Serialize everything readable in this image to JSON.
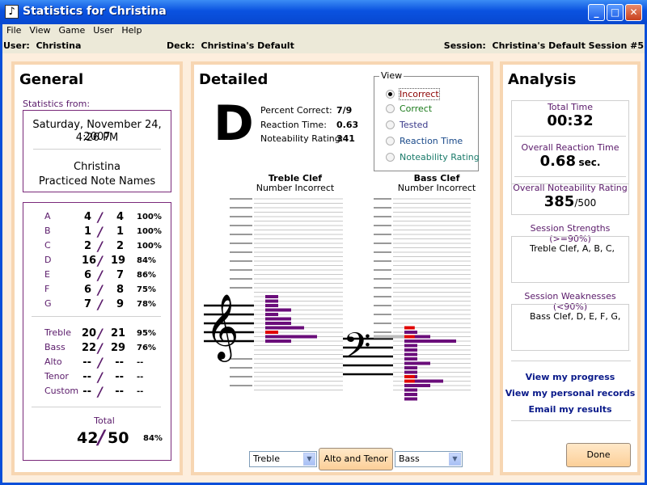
{
  "window": {
    "title": "Statistics for Christina"
  },
  "menu": [
    "File",
    "View",
    "Game",
    "User",
    "Help"
  ],
  "infobar": {
    "user_label": "User:",
    "user": "Christina",
    "deck_label": "Deck:",
    "deck": "Christina's Default",
    "session_label": "Session:",
    "session": "Christina's Default Session #5"
  },
  "general": {
    "title": "General",
    "stats_from_label": "Statistics from:",
    "date": "Saturday, November 24, 2007",
    "time": "4:26 PM",
    "user": "Christina",
    "activity": "Practiced Note Names",
    "notes": [
      {
        "label": "A",
        "a": "4",
        "b": "4",
        "pct": "100%"
      },
      {
        "label": "B",
        "a": "1",
        "b": "1",
        "pct": "100%"
      },
      {
        "label": "C",
        "a": "2",
        "b": "2",
        "pct": "100%"
      },
      {
        "label": "D",
        "a": "16",
        "b": "19",
        "pct": "84%"
      },
      {
        "label": "E",
        "a": "6",
        "b": "7",
        "pct": "86%"
      },
      {
        "label": "F",
        "a": "6",
        "b": "8",
        "pct": "75%"
      },
      {
        "label": "G",
        "a": "7",
        "b": "9",
        "pct": "78%"
      }
    ],
    "clefs": [
      {
        "label": "Treble",
        "a": "20",
        "b": "21",
        "pct": "95%"
      },
      {
        "label": "Bass",
        "a": "22",
        "b": "29",
        "pct": "76%"
      },
      {
        "label": "Alto",
        "a": "--",
        "b": "--",
        "pct": "--"
      },
      {
        "label": "Tenor",
        "a": "--",
        "b": "--",
        "pct": "--"
      },
      {
        "label": "Custom",
        "a": "--",
        "b": "--",
        "pct": "--"
      }
    ],
    "total_label": "Total",
    "total_a": "42",
    "total_b": "50",
    "total_pct": "84%"
  },
  "detailed": {
    "title": "Detailed",
    "grade": "D",
    "percent_correct_label": "Percent Correct:",
    "percent_correct": "7/9",
    "reaction_time_label": "Reaction Time:",
    "reaction_time": "0.63",
    "noteability_label": "Noteability Rating:",
    "noteability": "341",
    "view_legend": "View",
    "view_options": [
      "Incorrect",
      "Correct",
      "Tested",
      "Reaction Time",
      "Noteability Rating"
    ],
    "view_colors": [
      "#8b0000",
      "#1a7a1a",
      "#3a3a8a",
      "#1a4a8a",
      "#1a7a6a"
    ],
    "treble_title": "Treble Clef",
    "treble_sub": "Number Incorrect",
    "bass_title": "Bass Clef",
    "bass_sub": "Number Incorrect",
    "select_left": "Treble",
    "alto_tenor_button": "Alto and Tenor",
    "select_right": "Bass"
  },
  "analysis": {
    "title": "Analysis",
    "total_time_label": "Total Time",
    "total_time": "00:32",
    "reaction_label": "Overall Reaction Time",
    "reaction_value": "0.68",
    "reaction_unit": "sec.",
    "noteability_label": "Overall Noteability Rating",
    "noteability_value": "385",
    "noteability_unit": "/500",
    "strengths_label": "Session Strengths (>=90%)",
    "strengths": "Treble Clef, A, B, C,",
    "weaknesses_label": "Session Weaknesses (<90%)",
    "weaknesses": "Bass Clef, D, E, F, G,",
    "links": [
      "View my progress",
      "View my personal records",
      "Email my results"
    ],
    "done_button": "Done"
  },
  "chart_data": [
    {
      "type": "bar",
      "title": "Treble Clef",
      "subtitle": "Number Incorrect",
      "series": [
        {
          "values": [
            1,
            1,
            1,
            2,
            1,
            2,
            2,
            3,
            1,
            4,
            2
          ]
        },
        {
          "values": [
            0,
            0,
            0,
            0,
            0,
            0,
            0,
            0,
            1,
            0,
            0
          ]
        }
      ],
      "colors": [
        "#6a0d7a",
        "#e00000"
      ]
    },
    {
      "type": "bar",
      "title": "Bass Clef",
      "subtitle": "Number Incorrect",
      "series": [
        {
          "values": [
            0,
            1,
            2,
            4,
            1,
            1,
            1,
            1,
            2,
            1,
            1,
            1,
            3,
            2,
            1,
            1,
            1
          ]
        },
        {
          "values": [
            1,
            0,
            1,
            0,
            0,
            0,
            0,
            0,
            0,
            0,
            0,
            1,
            1,
            0,
            0,
            0,
            0
          ]
        }
      ],
      "colors": [
        "#6a0d7a",
        "#e00000"
      ]
    }
  ]
}
